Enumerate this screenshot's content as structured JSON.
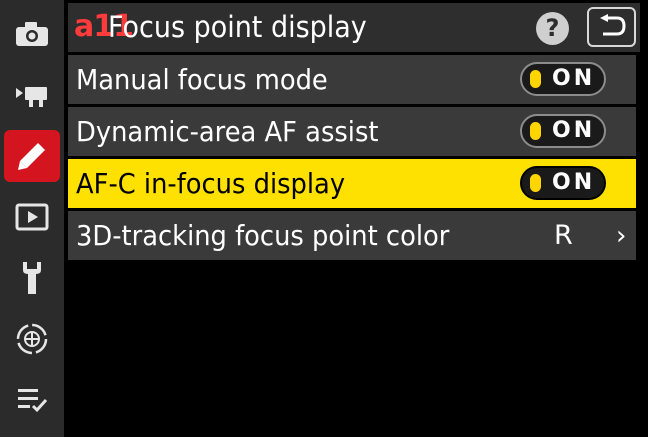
{
  "sidebar": {
    "items": [
      {
        "icon": "camera-icon"
      },
      {
        "icon": "movie-camera-icon"
      },
      {
        "icon": "pencil-icon",
        "active": true
      },
      {
        "icon": "playback-icon"
      },
      {
        "icon": "wrench-icon"
      },
      {
        "icon": "network-icon"
      },
      {
        "icon": "my-menu-icon"
      }
    ]
  },
  "header": {
    "code": "a11",
    "title": "Focus point display",
    "help_label": "?"
  },
  "menu": {
    "items": [
      {
        "label": "Manual focus mode",
        "toggle": "ON"
      },
      {
        "label": "Dynamic-area AF assist",
        "toggle": "ON"
      },
      {
        "label": "AF-C in-focus display",
        "toggle": "ON",
        "selected": true
      },
      {
        "label": "3D-tracking focus point color",
        "value": "R",
        "chevron": "›"
      }
    ]
  },
  "colors": {
    "accent_red": "#d4141f",
    "selection_yellow": "#ffe100",
    "toggle_indicator": "#ffd500"
  }
}
